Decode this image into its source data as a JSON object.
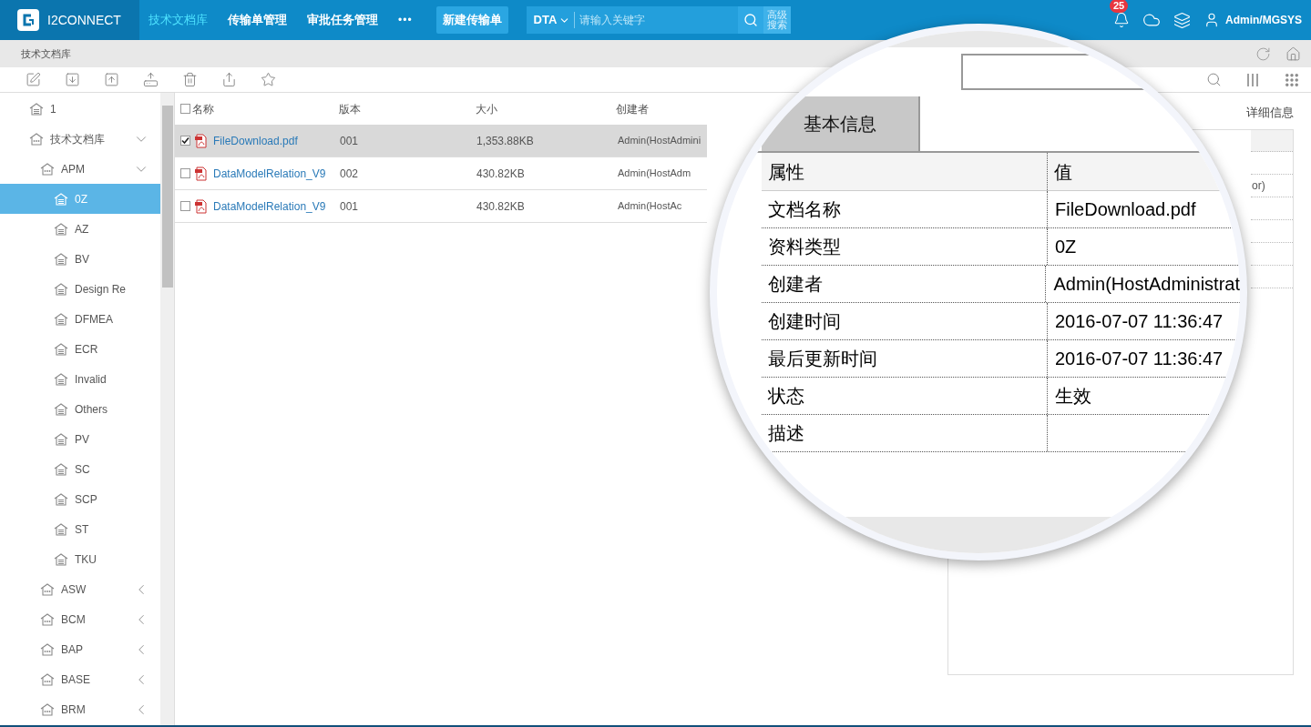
{
  "topbar": {
    "logo_text": "I2CONNECT",
    "nav": [
      {
        "label": "技术文档库",
        "selected": true
      },
      {
        "label": "传输单管理",
        "selected": false
      },
      {
        "label": "审批任务管理",
        "selected": false
      }
    ],
    "more": "•••",
    "new_button": "新建传输单",
    "search": {
      "scope": "DTA",
      "placeholder": "请输入关键字",
      "advanced": "高级搜索"
    },
    "notification_count": "25",
    "user": "Admin/MGSYS"
  },
  "breadcrumb": "技术文档库",
  "tree": [
    {
      "label": "1",
      "kind": "leaf",
      "selected": false
    },
    {
      "label": "技术文档库",
      "kind": "folder",
      "selected": false,
      "expanded": true,
      "children": [
        {
          "label": "APM",
          "kind": "folder",
          "selected": false,
          "expanded": true,
          "children": [
            {
              "label": "0Z",
              "kind": "leaf",
              "selected": true
            },
            {
              "label": "AZ",
              "kind": "leaf",
              "selected": false
            },
            {
              "label": "BV",
              "kind": "leaf",
              "selected": false
            },
            {
              "label": "Design Re",
              "kind": "leaf",
              "selected": false
            },
            {
              "label": "DFMEA",
              "kind": "leaf",
              "selected": false
            },
            {
              "label": "ECR",
              "kind": "leaf",
              "selected": false
            },
            {
              "label": "Invalid",
              "kind": "leaf",
              "selected": false
            },
            {
              "label": "Others",
              "kind": "leaf",
              "selected": false
            },
            {
              "label": "PV",
              "kind": "leaf",
              "selected": false
            },
            {
              "label": "SC",
              "kind": "leaf",
              "selected": false
            },
            {
              "label": "SCP",
              "kind": "leaf",
              "selected": false
            },
            {
              "label": "ST",
              "kind": "leaf",
              "selected": false
            },
            {
              "label": "TKU",
              "kind": "leaf",
              "selected": false
            }
          ]
        },
        {
          "label": "ASW",
          "kind": "folder",
          "selected": false,
          "expanded": false
        },
        {
          "label": "BCM",
          "kind": "folder",
          "selected": false,
          "expanded": false
        },
        {
          "label": "BAP",
          "kind": "folder",
          "selected": false,
          "expanded": false
        },
        {
          "label": "BASE",
          "kind": "folder",
          "selected": false,
          "expanded": false
        },
        {
          "label": "BRM",
          "kind": "folder",
          "selected": false,
          "expanded": false
        }
      ]
    }
  ],
  "file_table": {
    "select_all_checked": false,
    "columns": [
      "名称",
      "版本",
      "大小",
      "创建者"
    ],
    "rows": [
      {
        "name": "FileDownload.pdf",
        "version": "001",
        "size": "1,353.88KB",
        "creator": "Admin(HostAdmini",
        "checked": true,
        "selected": true
      },
      {
        "name": "DataModelRelation_V9",
        "version": "002",
        "size": "430.82KB",
        "creator": "Admin(HostAdm",
        "checked": false,
        "selected": false
      },
      {
        "name": "DataModelRelation_V9",
        "version": "001",
        "size": "430.82KB",
        "creator": "Admin(HostAc",
        "checked": false,
        "selected": false
      }
    ]
  },
  "detail_panel": {
    "tab": "详细信息",
    "cell_fragment": "or)"
  },
  "magnifier": {
    "tab": "基本信息",
    "columns": [
      "属性",
      "值"
    ],
    "rows": [
      {
        "property": "文档名称",
        "value": "FileDownload.pdf"
      },
      {
        "property": "资料类型",
        "value": "0Z"
      },
      {
        "property": "创建者",
        "value": "Admin(HostAdministrat"
      },
      {
        "property": "创建时间",
        "value": "2016-07-07 11:36:47"
      },
      {
        "property": "最后更新时间",
        "value": "2016-07-07 11:36:47"
      },
      {
        "property": "状态",
        "value": "生效"
      },
      {
        "property": "描述"
      }
    ]
  }
}
